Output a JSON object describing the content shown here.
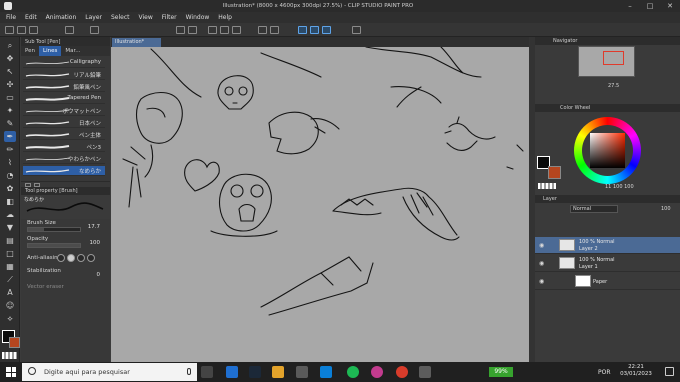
{
  "window": {
    "title": "Illustration* (8000 x 4600px 300dpi 27.5%) - CLIP STUDIO PAINT PRO",
    "controls": [
      "–",
      "□",
      "✕"
    ]
  },
  "menu": [
    "File",
    "Edit",
    "Animation",
    "Layer",
    "Select",
    "View",
    "Filter",
    "Window",
    "Help"
  ],
  "subtool": {
    "header": "Sub Tool [Pen]",
    "tabs": [
      "Pen",
      "Lines",
      "Mar..."
    ],
    "active_tab": 1,
    "brushes": [
      {
        "name": "Calligraphy"
      },
      {
        "name": "リアル鉛筆"
      },
      {
        "name": "鉛筆風ペン"
      },
      {
        "name": "Tapered Pen"
      },
      {
        "name": "ポウマットペン"
      },
      {
        "name": "日本ペン"
      },
      {
        "name": "ペン主体"
      },
      {
        "name": "ペン3"
      },
      {
        "name": "やわらかペン"
      },
      {
        "name": "なめらか",
        "selected": true
      }
    ]
  },
  "tool_property": {
    "header": "Tool property [Brush]",
    "brush_label": "なめらか",
    "brush_size_label": "Brush Size",
    "brush_size": "17.7",
    "opacity_label": "Opacity",
    "opacity": "100",
    "opacity_level": 1.0,
    "brush_size_level": 0.3,
    "anti_aliasing_label": "Anti-aliasing",
    "stabilization_label": "Stabilization",
    "stabilization": "0",
    "vector_label": "Vector eraser"
  },
  "canvas": {
    "tab": "Illustration*"
  },
  "navigator": {
    "header": "Navigator",
    "zoom": "27.5"
  },
  "color": {
    "header": "Color Wheel",
    "main": "#0a0a0a",
    "sub": "#b5461f",
    "rgb": [
      "11",
      "100",
      "100"
    ]
  },
  "layer": {
    "header": "Layer",
    "blend_mode": "Normal",
    "opacity_value": "100",
    "layers": [
      {
        "line1": "100 % Normal",
        "line2": "Layer 2",
        "selected": true
      },
      {
        "line1": "100 % Normal",
        "line2": "Layer 1",
        "selected": false
      },
      {
        "line1": "",
        "line2": "Paper",
        "selected": false
      }
    ]
  },
  "taskbar": {
    "search_placeholder": "Digite aqui para pesquisar",
    "battery": "99%",
    "language": "POR",
    "time": "22:21",
    "date": "03/01/2023"
  }
}
